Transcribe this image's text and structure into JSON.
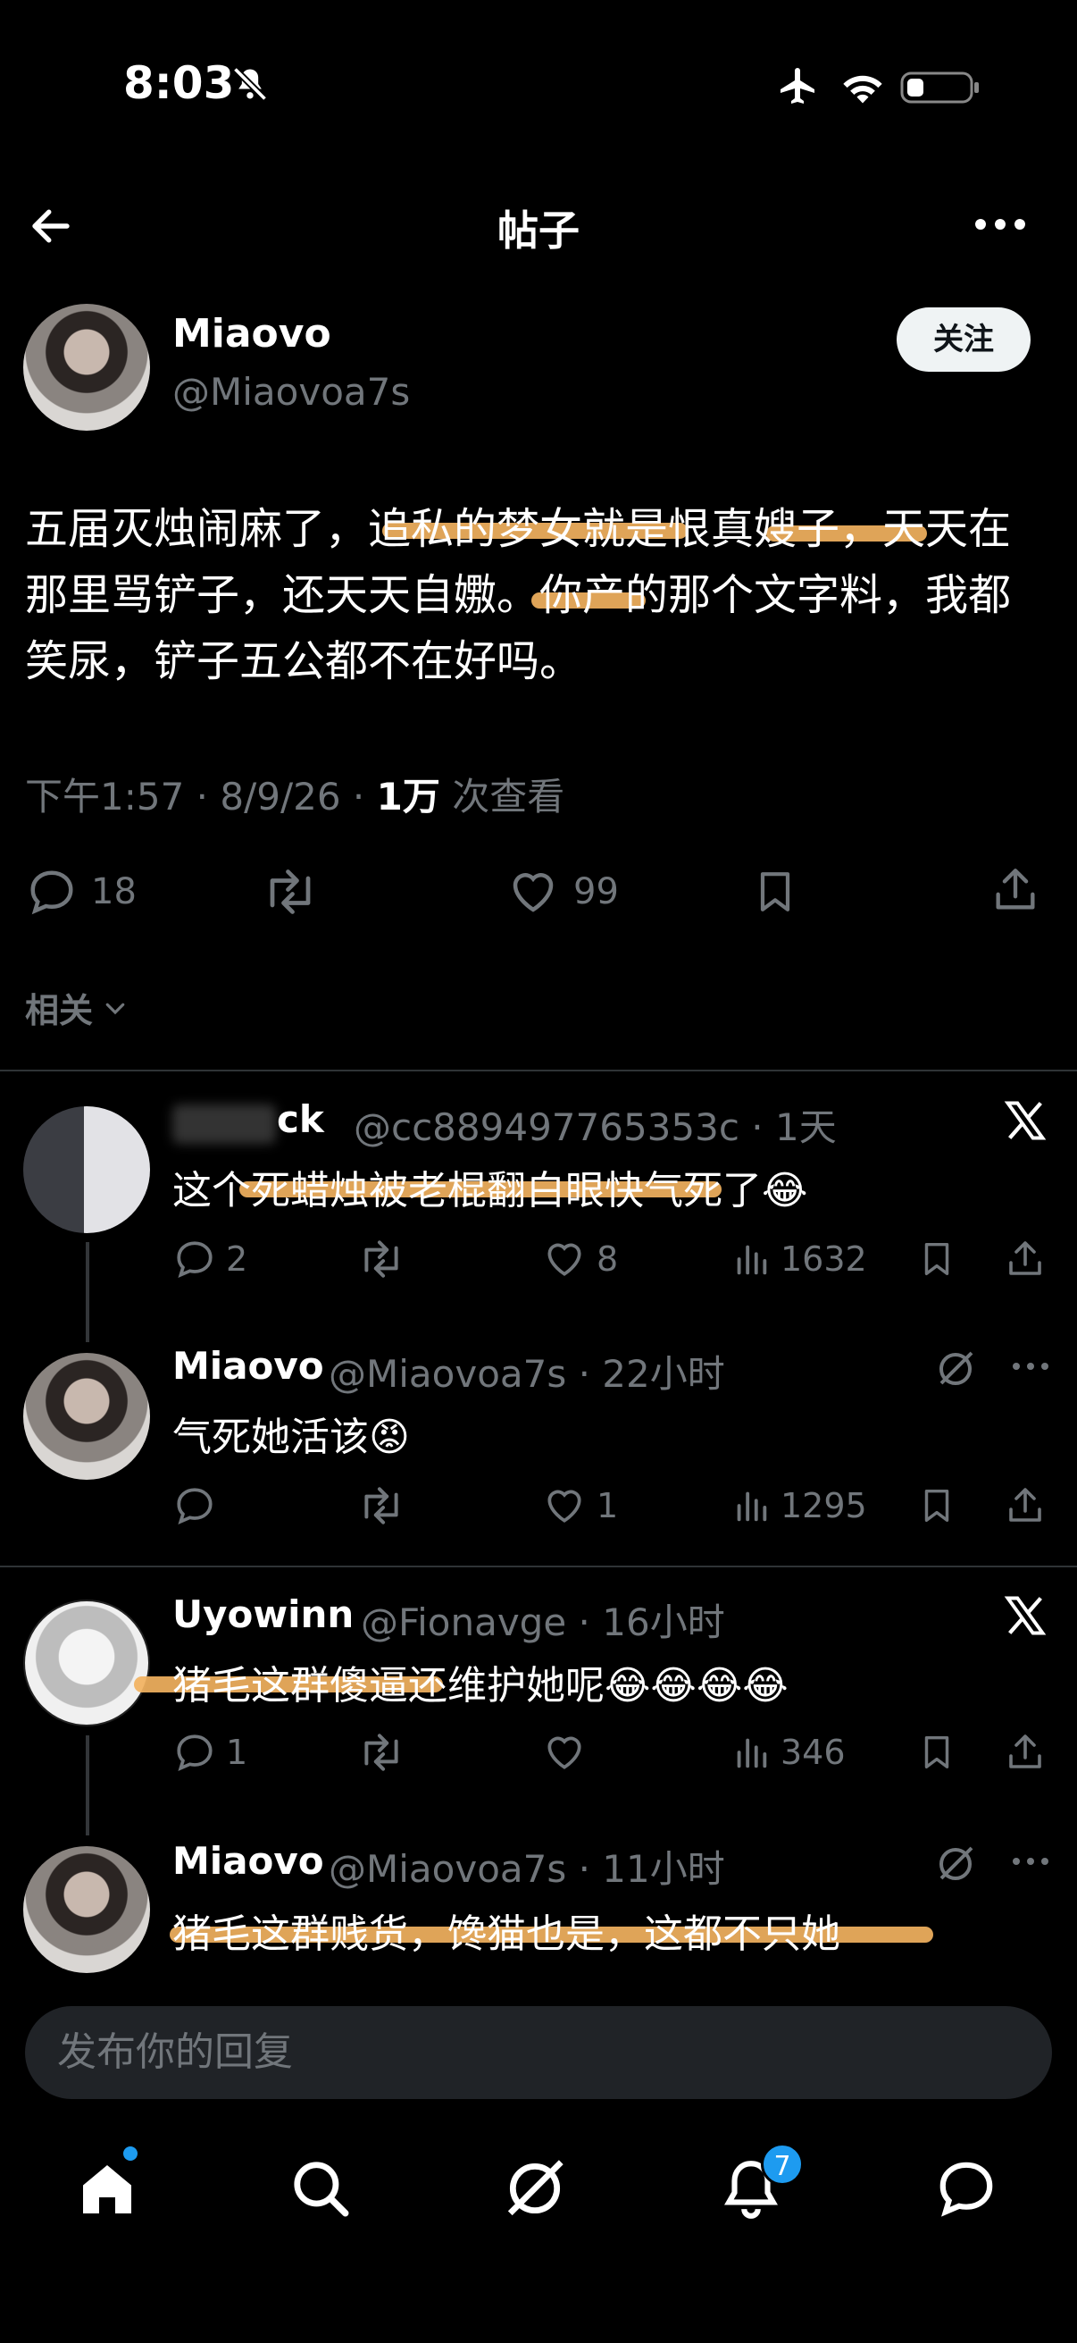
{
  "status_bar": {
    "time": "8:03"
  },
  "header": {
    "title": "帖子"
  },
  "post": {
    "name": "Miaovo",
    "handle": "@Miaovoa7s",
    "follow_label": "关注",
    "text": "五届灭烛闹麻了，追私的梦女就是恨真嫂子，天天在那里骂铲子，还天天自嫐。你产的那个文字料，我都笑尿，铲子五公都不在好吗。",
    "meta_time": "下午1:57 · 8/9/26 · ",
    "views": "1万",
    "views_label": " 次查看",
    "replies": "18",
    "likes": "99"
  },
  "related_label": "相关",
  "replies": [
    {
      "name": "ck",
      "handle": "@cc889497765353c",
      "time": "· 1天",
      "text": "这个死蜡烛被老棍翻白眼快气死了😂",
      "replies": "2",
      "likes": "8",
      "views": "1632"
    },
    {
      "name": "Miaovo",
      "handle": "@Miaovoa7s",
      "time": "· 22小时",
      "text": "气死她活该😡",
      "replies": "",
      "likes": "1",
      "views": "1295"
    },
    {
      "name": "Uyowinn",
      "handle": "@Fionavge",
      "time": "· 16小时",
      "text": "猪毛这群傻逼还维护她呢😂😂😂😂",
      "replies": "1",
      "likes": "",
      "views": "346"
    },
    {
      "name": "Miaovo",
      "handle": "@Miaovoa7s",
      "time": "· 11小时",
      "text": "猪毛这群贱货，馋猫也是，这都不只她"
    }
  ],
  "reply_box": {
    "placeholder": "发布你的回复"
  },
  "nav": {
    "notifications_count": "7"
  },
  "colors": {
    "accent": "#1d9bf0",
    "highlight": "#f2b25f",
    "background": "#000000"
  }
}
